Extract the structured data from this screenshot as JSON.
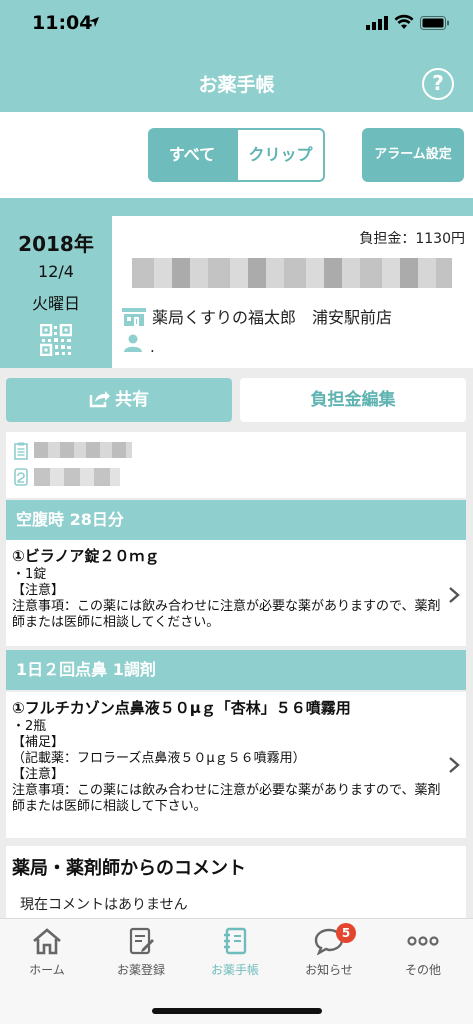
{
  "status_bar": {
    "time": "11:04"
  },
  "nav": {
    "title": "お薬手帳",
    "help_label": "?"
  },
  "segment": {
    "all_label": "すべて",
    "clip_label": "クリップ",
    "alarm_label": "アラーム設定"
  },
  "record": {
    "year": "2018年",
    "month_day": "12/4",
    "weekday": "火曜日",
    "fee": "負担金：1130円",
    "pharmacy": "薬局くすりの福太郎　浦安駅前店",
    "pharmacist": "."
  },
  "actions": {
    "share_label": "共有",
    "fee_edit_label": "負担金編集"
  },
  "sections": [
    {
      "header": "空腹時 28日分",
      "drug": "①ビラノア錠２０ｍｇ",
      "lines": [
        "・1錠",
        "【注意】",
        "注意事項：この薬には飲み合わせに注意が必要な薬がありますので、薬剤師または医師に相談してください。"
      ]
    },
    {
      "header": "1日２回点鼻 1調剤",
      "drug": "①フルチカゾン点鼻液５０μｇ「杏林」５６噴霧用",
      "lines": [
        "・2瓶",
        "【補足】",
        "（記載薬：フロラーズ点鼻液５０μｇ５６噴霧用）",
        "【注意】",
        "注意事項：この薬には飲み合わせに注意が必要な薬がありますので、薬剤師または医師に相談して下さい。"
      ]
    }
  ],
  "comments": {
    "title": "薬局・薬剤師からのコメント",
    "body": "現在コメントはありません"
  },
  "tabs": [
    {
      "label": "ホーム",
      "icon": "home-icon"
    },
    {
      "label": "お薬登録",
      "icon": "register-icon"
    },
    {
      "label": "お薬手帳",
      "icon": "notebook-icon",
      "active": true
    },
    {
      "label": "お知らせ",
      "icon": "chat-bubble-icon",
      "badge": "5"
    },
    {
      "label": "その他",
      "icon": "more-icon"
    }
  ],
  "colors": {
    "accent": "#8fcfcd",
    "accent_dark": "#6fbcbc",
    "badge": "#e3452f"
  }
}
